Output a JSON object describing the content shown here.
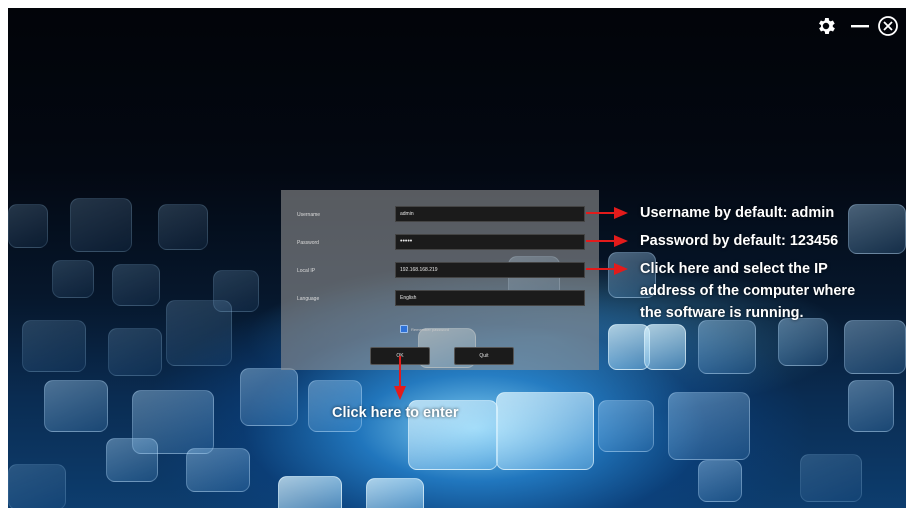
{
  "window": {
    "settings_icon": "gear-icon",
    "minimize_icon": "minimize-icon",
    "close_icon": "close-circle-icon"
  },
  "login": {
    "username": {
      "label": "Username",
      "value": "admin"
    },
    "password": {
      "label": "Password",
      "value": "•••••"
    },
    "local_ip": {
      "label": "Local IP",
      "value": "192.168.168.219"
    },
    "language": {
      "label": "Language",
      "value": "English"
    },
    "remember": {
      "label": "Remember password",
      "checked": true
    },
    "ok_label": "OK",
    "quit_label": "Quit"
  },
  "annotations": {
    "username_note": "Username by default: admin",
    "password_note": "Password by default: 123456",
    "ip_note_line1": "Click here and select the IP",
    "ip_note_line2": "address of the computer where",
    "ip_note_line3": "the software is running.",
    "enter_note": "Click here to enter",
    "arrow_color": "#e31b1b"
  }
}
